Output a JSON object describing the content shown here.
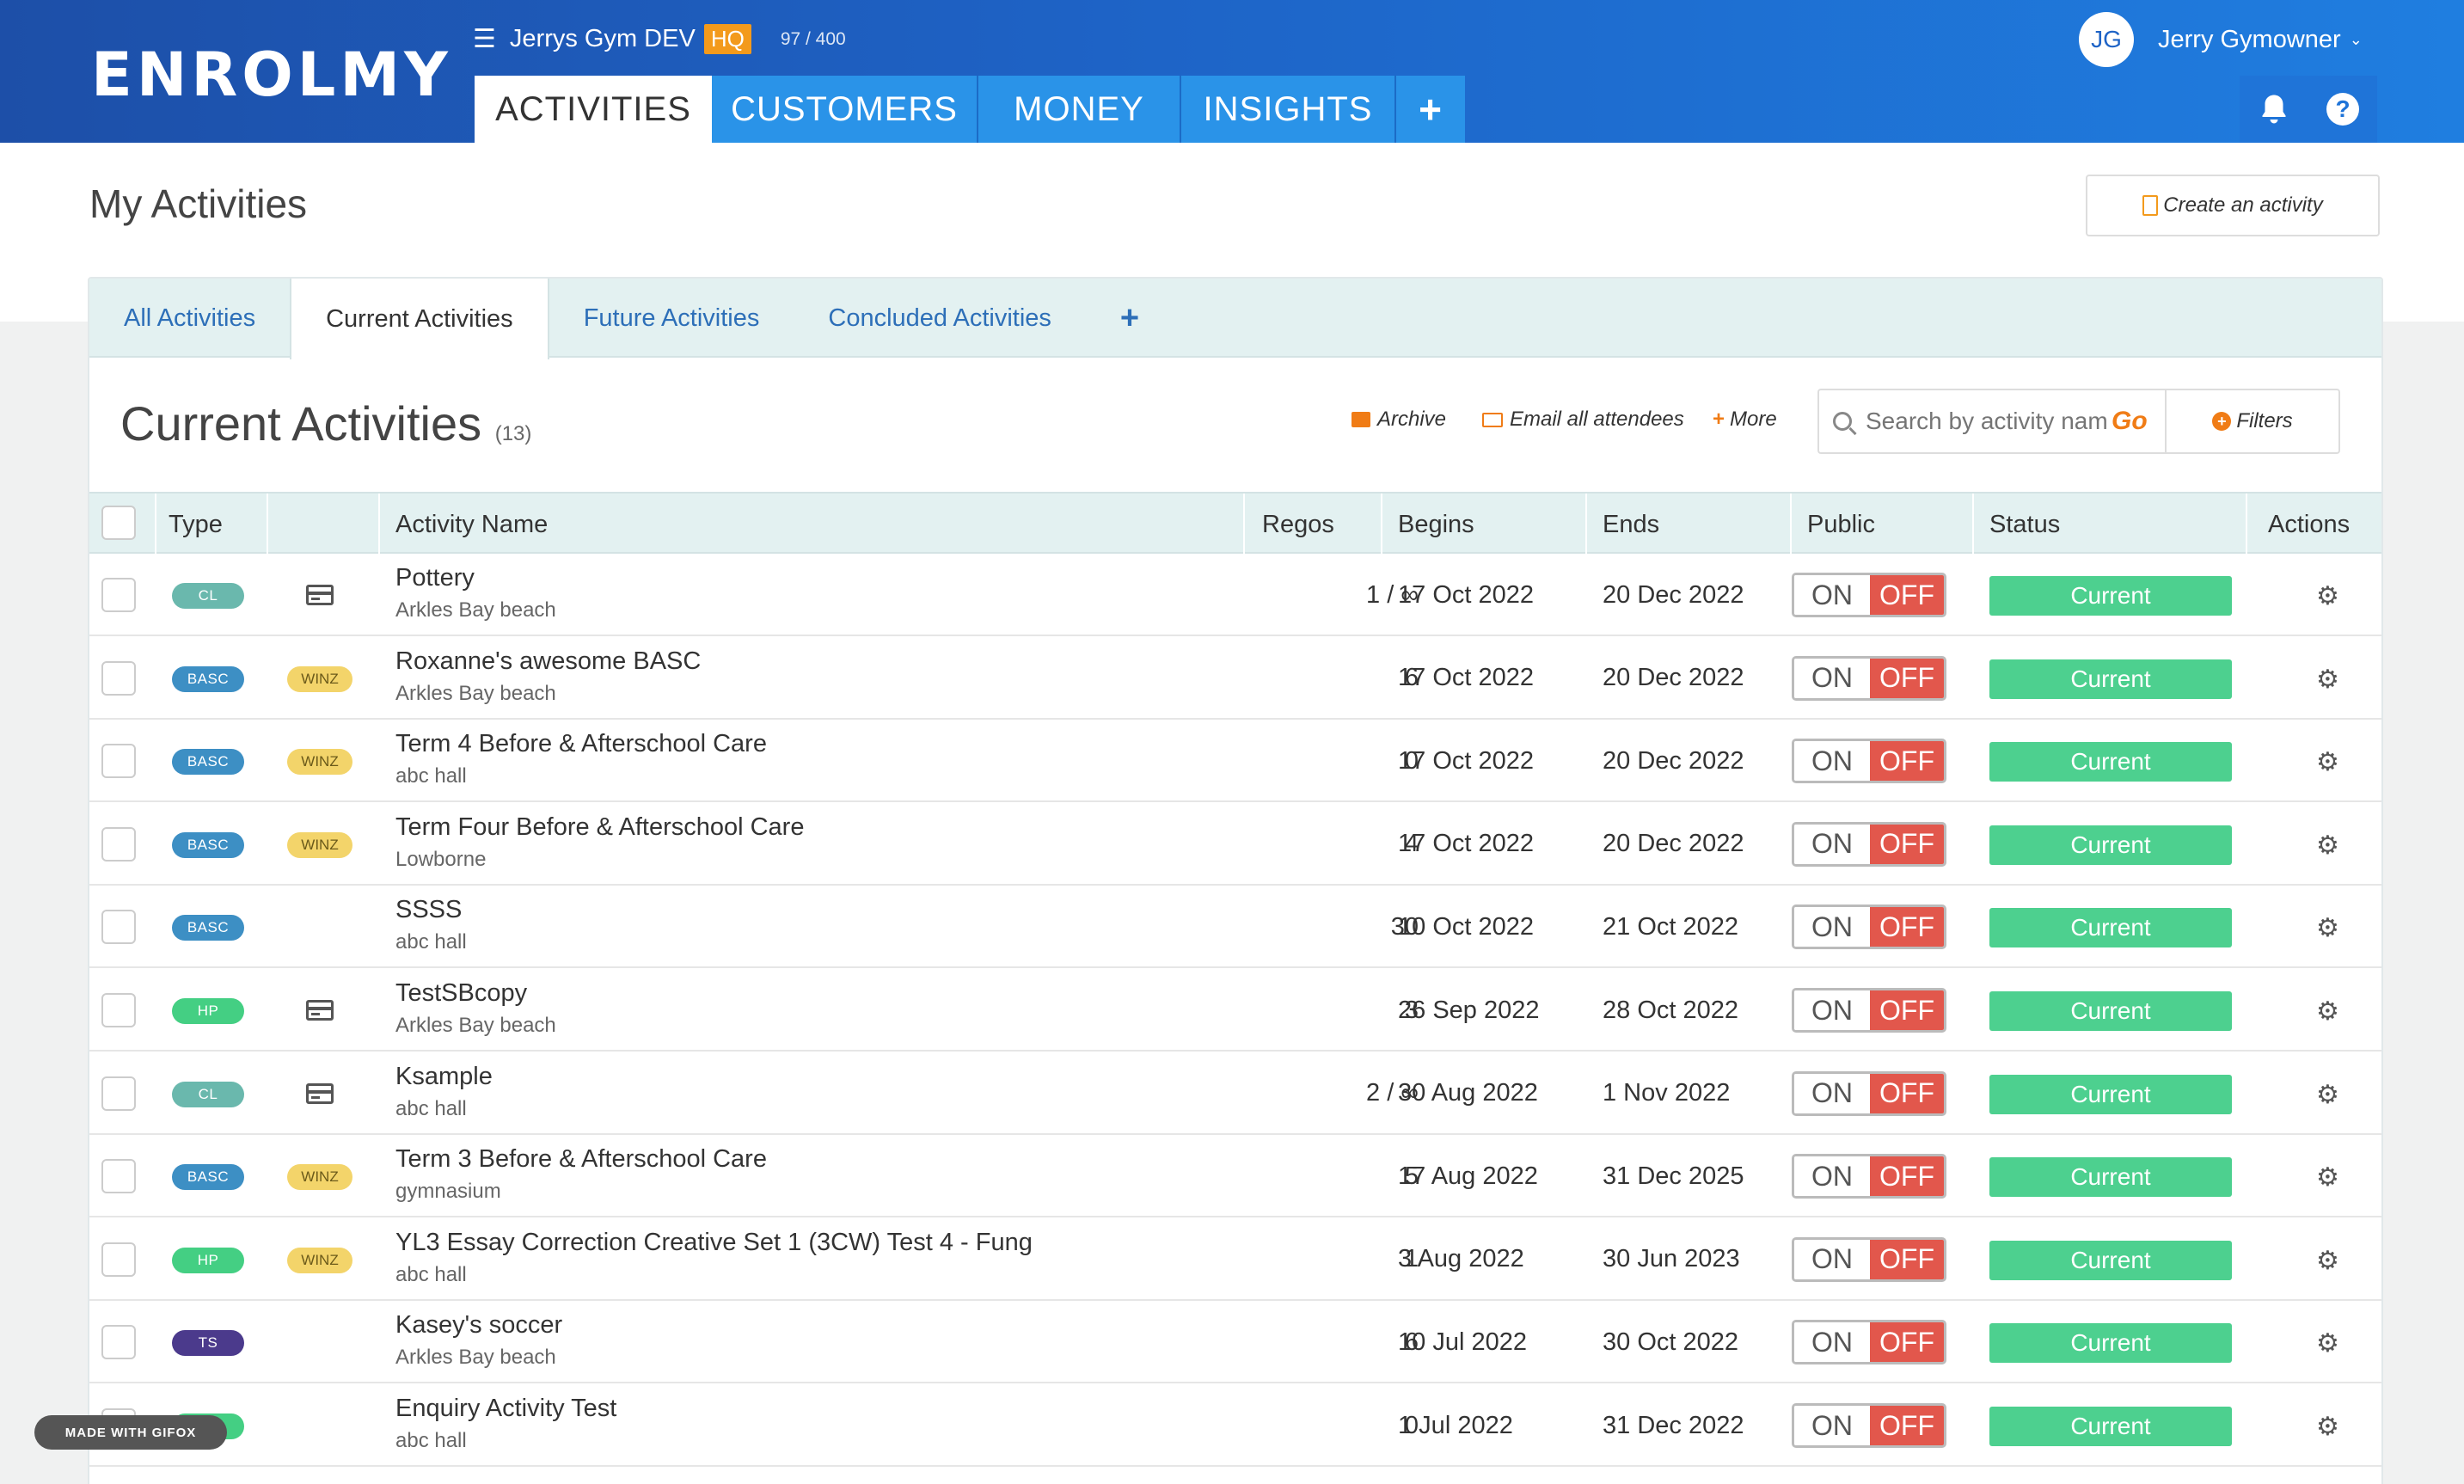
{
  "header": {
    "logo": "ENROLMY",
    "org_name": "Jerrys Gym DEV",
    "org_badge": "HQ",
    "usage": "97 / 400",
    "nav": [
      "ACTIVITIES",
      "CUSTOMERS",
      "MONEY",
      "INSIGHTS",
      "+"
    ],
    "user_initials": "JG",
    "user_name": "Jerry Gymowner",
    "colors": {
      "bar": "#1e63c6",
      "tab": "#2a93e8"
    }
  },
  "page": {
    "title": "My Activities",
    "create_label": "Create an activity"
  },
  "subtabs": [
    "All Activities",
    "Current Activities",
    "Future Activities",
    "Concluded Activities",
    "+"
  ],
  "section": {
    "title": "Current Activities",
    "count": "(13)",
    "archive": "Archive",
    "email": "Email all attendees",
    "more": "More",
    "search_placeholder": "Search by activity name",
    "go": "Go",
    "filters": "Filters"
  },
  "table": {
    "columns": [
      "Type",
      "Activity Name",
      "Regos",
      "Begins",
      "Ends",
      "Public",
      "Status",
      "Actions"
    ],
    "toggle_on": "ON",
    "toggle_off": "OFF",
    "rows": [
      {
        "type": "CL",
        "extra": "card",
        "name": "Pottery",
        "location": "Arkles Bay beach",
        "regos": "1 / ∞",
        "begins": "17 Oct 2022",
        "ends": "20 Dec 2022",
        "status": "Current"
      },
      {
        "type": "BASC",
        "extra": "WINZ",
        "name": "Roxanne's awesome BASC",
        "location": "Arkles Bay beach",
        "regos": "6",
        "begins": "17 Oct 2022",
        "ends": "20 Dec 2022",
        "status": "Current"
      },
      {
        "type": "BASC",
        "extra": "WINZ",
        "name": "Term 4 Before & Afterschool Care",
        "location": "abc hall",
        "regos": "0",
        "begins": "17 Oct 2022",
        "ends": "20 Dec 2022",
        "status": "Current"
      },
      {
        "type": "BASC",
        "extra": "WINZ",
        "name": "Term Four Before & Afterschool Care",
        "location": "Lowborne",
        "regos": "4",
        "begins": "17 Oct 2022",
        "ends": "20 Dec 2022",
        "status": "Current"
      },
      {
        "type": "BASC",
        "extra": "",
        "name": "SSSS",
        "location": "abc hall",
        "regos": "30",
        "begins": "10 Oct 2022",
        "ends": "21 Oct 2022",
        "status": "Current"
      },
      {
        "type": "HP",
        "extra": "card",
        "name": "TestSBcopy",
        "location": "Arkles Bay beach",
        "regos": "3",
        "begins": "26 Sep 2022",
        "ends": "28 Oct 2022",
        "status": "Current"
      },
      {
        "type": "CL",
        "extra": "card",
        "name": "Ksample",
        "location": "abc hall",
        "regos": "2 / ∞",
        "begins": "30 Aug 2022",
        "ends": "1 Nov 2022",
        "status": "Current"
      },
      {
        "type": "BASC",
        "extra": "WINZ",
        "name": "Term 3 Before & Afterschool Care",
        "location": "gymnasium",
        "regos": "5",
        "begins": "17 Aug 2022",
        "ends": "31 Dec 2025",
        "status": "Current"
      },
      {
        "type": "HP",
        "extra": "WINZ",
        "name": "YL3 Essay Correction Creative Set 1 (3CW) Test 4 - Fung",
        "location": "abc hall",
        "regos": "1",
        "begins": "3 Aug 2022",
        "ends": "30 Jun 2023",
        "status": "Current"
      },
      {
        "type": "TS",
        "extra": "",
        "name": "Kasey's soccer",
        "location": "Arkles Bay beach",
        "regos": "6",
        "begins": "10 Jul 2022",
        "ends": "30 Oct 2022",
        "status": "Current"
      },
      {
        "type": "",
        "extra": "",
        "name": "Enquiry Activity Test",
        "location": "abc hall",
        "regos": "0",
        "begins": "1 Jul 2022",
        "ends": "31 Dec 2022",
        "status": "Current"
      }
    ],
    "type_colors": {
      "CL": "#6ab8ad",
      "BASC": "#3d8fc4",
      "HP": "#44cf83",
      "TS": "#4b3a8c",
      "": "#44cf83"
    }
  },
  "watermark": "MADE WITH GIFOX"
}
